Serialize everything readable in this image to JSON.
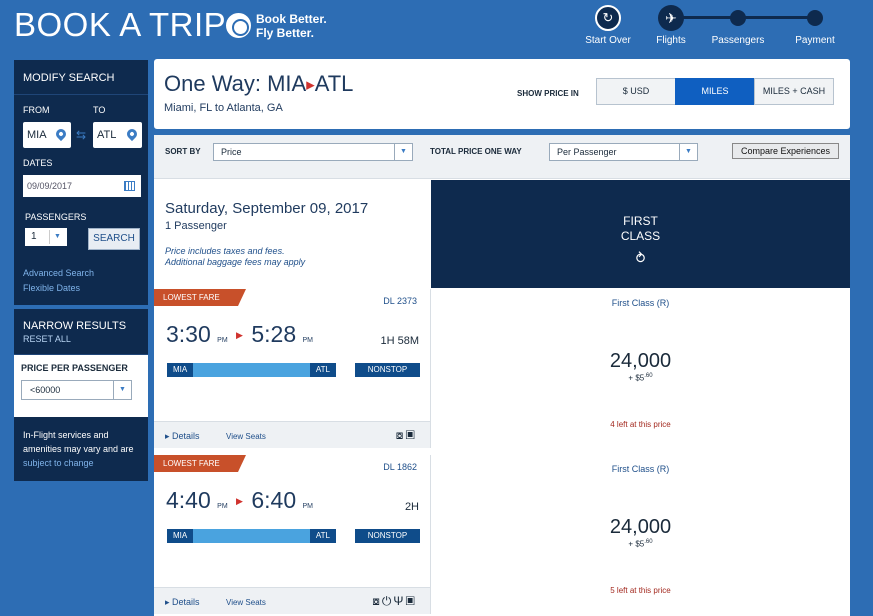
{
  "header": {
    "brand": "BOOK A TRIP",
    "tagline_line1": "Book Better.",
    "tagline_line2": "Fly Better.",
    "steps": [
      {
        "label": "Start Over"
      },
      {
        "label": "Flights"
      },
      {
        "label": "Passengers"
      },
      {
        "label": "Payment"
      }
    ]
  },
  "modify_search": {
    "title": "MODIFY SEARCH",
    "from_label": "FROM",
    "to_label": "TO",
    "from_value": "MIA",
    "to_value": "ATL",
    "dates_label": "DATES",
    "date_value": "09/09/2017",
    "passengers_label": "PASSENGERS",
    "passengers_value": "1",
    "search_button": "SEARCH",
    "advanced_search": "Advanced Search",
    "flexible_dates": "Flexible Dates"
  },
  "narrow_results": {
    "title": "NARROW RESULTS",
    "reset_all": "RESET ALL",
    "price_per_passenger_label": "PRICE PER PASSENGER",
    "price_value": "<60000",
    "inflight_text": "In-Flight services and amenities may vary and are",
    "inflight_link": "subject to change"
  },
  "trip": {
    "title_prefix": "One Way: MIA",
    "title_suffix": "ATL",
    "subtitle": "Miami, FL to Atlanta, GA",
    "show_price_label": "SHOW PRICE IN",
    "price_options": [
      "$ USD",
      "MILES",
      "MILES + CASH"
    ],
    "active_price_option": "MILES"
  },
  "sort": {
    "sort_by_label": "SORT BY",
    "sort_value": "Price",
    "total_price_label": "TOTAL PRICE ONE WAY",
    "total_price_value": "Per Passenger",
    "compare_button": "Compare Experiences"
  },
  "date_header": {
    "date": "Saturday, September 09, 2017",
    "passengers": "1 Passenger",
    "note_line1": "Price includes taxes and fees.",
    "note_line2": "Additional baggage fees may apply"
  },
  "cabin_header": {
    "line1": "FIRST",
    "line2": "CLASS"
  },
  "flights": [
    {
      "tag": "LOWEST FARE",
      "flight_number": "DL 2373",
      "depart_time": "3:30",
      "depart_ampm": "PM",
      "arrive_time": "5:28",
      "arrive_ampm": "PM",
      "duration": "1H 58M",
      "origin": "MIA",
      "destination": "ATL",
      "stops": "NONSTOP",
      "details": "Details",
      "view_seats": "View Seats",
      "fare_class": "First Class (R)",
      "miles": "24,000",
      "cash_prefix": "+ $",
      "cash_dollars": "5",
      "cash_cents": ".60",
      "seats_left": "4 left at this price"
    },
    {
      "tag": "LOWEST FARE",
      "flight_number": "DL 1862",
      "depart_time": "4:40",
      "depart_ampm": "PM",
      "arrive_time": "6:40",
      "arrive_ampm": "PM",
      "duration": "2H",
      "origin": "MIA",
      "destination": "ATL",
      "stops": "NONSTOP",
      "details": "Details",
      "view_seats": "View Seats",
      "fare_class": "First Class (R)",
      "miles": "24,000",
      "cash_prefix": "+ $",
      "cash_dollars": "5",
      "cash_cents": ".60",
      "seats_left": "5 left at this price"
    }
  ],
  "colors": {
    "page_bg": "#2d6db4",
    "navy": "#0e2a4e",
    "accent_blue": "#0f5fc1",
    "fare_tag": "#c8502a",
    "alert_red": "#a3291f"
  }
}
